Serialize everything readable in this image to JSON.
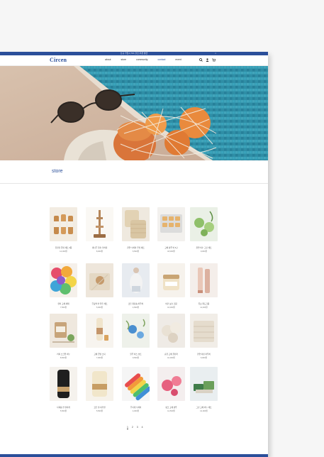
{
  "topbar": {
    "notice": "신규 가입시 5% 할인 쿠폰 발급",
    "close": "×"
  },
  "nav": {
    "logo": "Circen",
    "menu": [
      "about",
      "store",
      "community",
      "contact",
      "event"
    ],
    "icons": [
      "search-icon",
      "user-icon",
      "cart-icon"
    ]
  },
  "section": {
    "title": "store"
  },
  "products": [
    {
      "name": "친환경 립밤 세트 3종",
      "price": "12,000원"
    },
    {
      "name": "대나무 칫솔 거치대",
      "price": "8,000원"
    },
    {
      "name": "천연 수세미 주방 세트",
      "price": "6,500원"
    },
    {
      "name": "고체 샴푸 바 6구",
      "price": "18,000원"
    },
    {
      "name": "천연 비누 그린 세트",
      "price": "9,000원"
    },
    {
      "name": "컬러 고체 세제",
      "price": "7,500원"
    },
    {
      "name": "무표백 면 행주 세트",
      "price": "5,000원"
    },
    {
      "name": "코튼 화장솜 파우치",
      "price": "4,500원"
    },
    {
      "name": "비건 보습 크림",
      "price": "16,000원"
    },
    {
      "name": "튜브 핸드크림",
      "price": "11,000원"
    },
    {
      "name": "커피 스크럽 비누",
      "price": "8,500원"
    },
    {
      "name": "고체 립밤 스틱",
      "price": "7,000원"
    },
    {
      "name": "블루 바스 솔트",
      "price": "9,500원"
    },
    {
      "name": "순한 고체 클렌저",
      "price": "10,000원"
    },
    {
      "name": "천연 리넨 파우치",
      "price": "6,000원"
    },
    {
      "name": "다회용 면 실타래",
      "price": "5,500원"
    },
    {
      "name": "코튼 실 내추럴",
      "price": "5,500원"
    },
    {
      "name": "무지개 수세미",
      "price": "4,000원"
    },
    {
      "name": "핑크 고체 샴푸",
      "price": "12,500원"
    },
    {
      "name": "그린 고체 비누 세트",
      "price": "13,000원"
    }
  ],
  "pagination": [
    "1",
    "2",
    "3",
    "4"
  ],
  "side_number": "0-",
  "colors": {
    "brand": "#2b4f9a",
    "pool": "#2e8fa8",
    "sand": "#d9c5b2"
  }
}
